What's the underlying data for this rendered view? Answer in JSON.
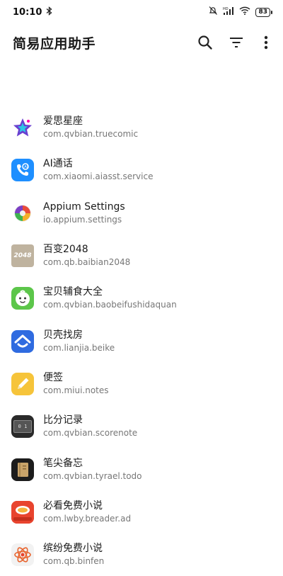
{
  "status": {
    "time": "10:10",
    "battery": "83",
    "hd_label": "HD"
  },
  "app_bar": {
    "title": "简易应用助手",
    "search_icon": "search-icon",
    "filter_icon": "filter-icon",
    "more_icon": "more-vert-icon"
  },
  "apps": [
    {
      "name": "爱思星座",
      "package": "com.qvbian.truecomic",
      "icon": "star-icon",
      "color": "#ffffff"
    },
    {
      "name": "AI通话",
      "package": "com.xiaomi.aiasst.service",
      "icon": "phone-icon",
      "color": "#1e8fff"
    },
    {
      "name": "Appium Settings",
      "package": "io.appium.settings",
      "icon": "appium-icon",
      "color": "#ffffff"
    },
    {
      "name": "百变2048",
      "package": "com.qb.baibian2048",
      "icon": "tile-2048-icon",
      "color": "#bfb39f",
      "icon_text": "2048"
    },
    {
      "name": "宝贝辅食大全",
      "package": "com.qvbian.baobeifushidaquan",
      "icon": "baby-face-icon",
      "color": "#5cc64a"
    },
    {
      "name": "贝壳找房",
      "package": "com.lianjia.beike",
      "icon": "house-icon",
      "color": "#2f6be0"
    },
    {
      "name": "便签",
      "package": "com.miui.notes",
      "icon": "pencil-icon",
      "color": "#f6c43a"
    },
    {
      "name": "比分记录",
      "package": "com.qvbian.scorenote",
      "icon": "scoreboard-icon",
      "color": "#2a2a2a",
      "icon_text": "0 1"
    },
    {
      "name": "笔尖备忘",
      "package": "com.qvbian.tyrael.todo",
      "icon": "notebook-icon",
      "color": "#1c1c1c"
    },
    {
      "name": "必看免费小说",
      "package": "com.lwby.breader.ad",
      "icon": "book-app-icon",
      "color": "#e8442e"
    },
    {
      "name": "缤纷免费小说",
      "package": "com.qb.binfen",
      "icon": "atom-icon",
      "color": "#f2f2f2"
    }
  ]
}
